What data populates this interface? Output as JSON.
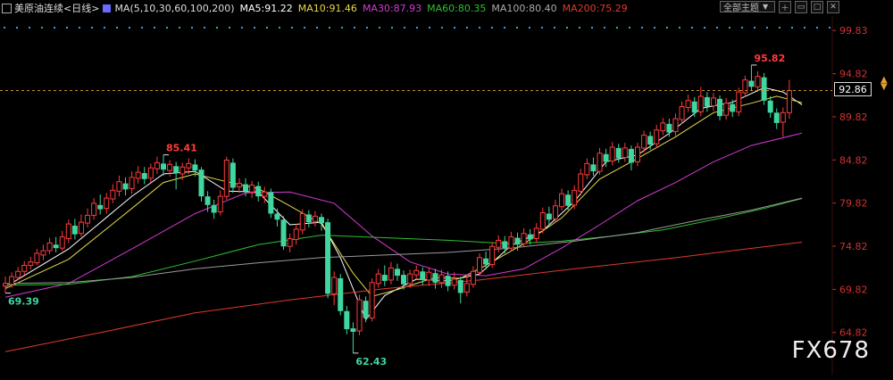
{
  "header": {
    "symbol": "美原油连续",
    "period": "<日线>",
    "ma_label": "MA(5,10,30,60,100,200)",
    "ma5": "MA5:91.22",
    "ma10": "MA10:91.46",
    "ma30": "MA30:87.93",
    "ma60": "MA60:80.35",
    "ma100": "MA100:80.40",
    "ma200": "MA200:75.29",
    "dropdown": "全部主题",
    "colors": {
      "ma5": "#ffffff",
      "ma10": "#e6d94a",
      "ma30": "#d23bd2",
      "ma60": "#2fbf2f",
      "ma100": "#9a9a9a",
      "ma200": "#e03a2a"
    }
  },
  "price_box": "92.86",
  "watermark": "FX678",
  "chart_data": {
    "type": "candlestick",
    "y_ticks": [
      "99.83",
      "94.82",
      "89.82",
      "84.82",
      "79.82",
      "74.82",
      "69.82",
      "64.82"
    ],
    "ylim": [
      62.0,
      101.5
    ],
    "current_price": 92.86,
    "annotations": [
      {
        "label": "85.41",
        "value": 85.41,
        "type": "high"
      },
      {
        "label": "69.39",
        "value": 69.39,
        "type": "low"
      },
      {
        "label": "62.43",
        "value": 62.43,
        "type": "low"
      },
      {
        "label": "95.82",
        "value": 95.82,
        "type": "high"
      }
    ],
    "candles": [
      [
        70.2,
        70.5,
        71.3,
        69.39
      ],
      [
        70.4,
        71.3,
        71.8,
        70.0
      ],
      [
        71.2,
        71.9,
        72.4,
        70.9
      ],
      [
        71.9,
        72.6,
        73.1,
        71.5
      ],
      [
        72.6,
        73.0,
        73.6,
        72.1
      ],
      [
        72.9,
        74.0,
        74.5,
        72.6
      ],
      [
        73.8,
        74.3,
        75.0,
        73.2
      ],
      [
        74.3,
        75.2,
        75.8,
        73.9
      ],
      [
        75.0,
        74.6,
        75.9,
        74.1
      ],
      [
        74.6,
        75.9,
        76.6,
        74.3
      ],
      [
        75.7,
        77.4,
        77.9,
        75.2
      ],
      [
        77.2,
        76.2,
        78.0,
        75.6
      ],
      [
        76.3,
        77.6,
        78.5,
        75.9
      ],
      [
        77.5,
        78.4,
        79.2,
        77.0
      ],
      [
        78.4,
        79.8,
        80.4,
        77.9
      ],
      [
        79.6,
        79.1,
        80.8,
        78.5
      ],
      [
        79.2,
        80.4,
        81.0,
        78.6
      ],
      [
        80.3,
        81.3,
        82.0,
        79.8
      ],
      [
        81.2,
        82.3,
        83.0,
        80.6
      ],
      [
        82.1,
        81.4,
        82.8,
        80.7
      ],
      [
        81.5,
        82.8,
        83.5,
        80.9
      ],
      [
        82.7,
        83.4,
        84.1,
        82.1
      ],
      [
        83.3,
        82.6,
        84.0,
        82.0
      ],
      [
        82.7,
        83.9,
        84.4,
        82.2
      ],
      [
        83.8,
        84.5,
        85.2,
        83.2
      ],
      [
        84.4,
        83.7,
        85.41,
        83.0
      ],
      [
        83.6,
        84.3,
        84.8,
        82.9
      ],
      [
        84.1,
        83.3,
        84.6,
        81.4
      ],
      [
        83.2,
        84.0,
        84.5,
        82.5
      ],
      [
        83.9,
        84.4,
        85.0,
        83.2
      ],
      [
        84.3,
        83.6,
        84.9,
        82.9
      ],
      [
        83.7,
        80.6,
        84.0,
        80.0
      ],
      [
        80.6,
        79.6,
        81.2,
        78.8
      ],
      [
        79.6,
        78.7,
        80.2,
        78.0
      ],
      [
        78.8,
        80.6,
        81.3,
        78.4
      ],
      [
        80.6,
        84.8,
        85.2,
        80.2
      ],
      [
        84.5,
        81.6,
        85.0,
        81.0
      ],
      [
        81.7,
        82.1,
        82.7,
        81.0
      ],
      [
        82.0,
        81.2,
        82.7,
        80.6
      ],
      [
        81.1,
        81.9,
        82.4,
        80.4
      ],
      [
        81.8,
        80.6,
        82.3,
        80.0
      ],
      [
        80.6,
        81.1,
        81.7,
        79.8
      ],
      [
        81.1,
        78.6,
        81.5,
        78.1
      ],
      [
        78.6,
        77.9,
        79.2,
        77.1
      ],
      [
        77.9,
        74.8,
        78.3,
        74.4
      ],
      [
        74.8,
        75.7,
        76.3,
        74.1
      ],
      [
        75.6,
        76.8,
        77.4,
        75.0
      ],
      [
        76.7,
        78.6,
        79.1,
        76.2
      ],
      [
        78.5,
        77.6,
        79.0,
        77.0
      ],
      [
        77.7,
        78.3,
        78.9,
        77.1
      ],
      [
        78.2,
        77.5,
        78.6,
        76.6
      ],
      [
        77.6,
        69.3,
        78.0,
        68.8
      ],
      [
        69.3,
        71.2,
        71.9,
        68.0
      ],
      [
        71.1,
        67.3,
        71.6,
        66.8
      ],
      [
        67.3,
        65.2,
        67.9,
        64.6
      ],
      [
        65.3,
        64.9,
        66.0,
        62.43
      ],
      [
        65.0,
        68.6,
        69.2,
        64.5
      ],
      [
        68.5,
        66.5,
        69.0,
        66.0
      ],
      [
        66.5,
        70.6,
        71.1,
        66.1
      ],
      [
        70.5,
        71.6,
        72.2,
        70.0
      ],
      [
        71.5,
        70.8,
        72.6,
        70.2
      ],
      [
        70.9,
        72.3,
        73.0,
        70.4
      ],
      [
        72.2,
        71.4,
        72.8,
        70.8
      ],
      [
        71.5,
        70.4,
        72.0,
        69.8
      ],
      [
        70.5,
        71.6,
        72.1,
        70.0
      ],
      [
        71.5,
        72.0,
        72.6,
        71.0
      ],
      [
        71.9,
        70.9,
        72.4,
        70.3
      ],
      [
        70.9,
        71.8,
        72.4,
        70.2
      ],
      [
        71.7,
        70.6,
        72.2,
        69.9
      ],
      [
        70.6,
        71.5,
        72.1,
        70.0
      ],
      [
        71.4,
        70.2,
        71.9,
        69.6
      ],
      [
        70.3,
        71.0,
        71.8,
        69.8
      ],
      [
        70.9,
        69.4,
        71.3,
        68.2
      ],
      [
        69.5,
        70.5,
        71.4,
        69.0
      ],
      [
        70.4,
        71.9,
        72.5,
        70.0
      ],
      [
        71.8,
        73.5,
        74.0,
        71.4
      ],
      [
        73.4,
        72.7,
        74.2,
        72.1
      ],
      [
        72.7,
        74.8,
        75.3,
        72.3
      ],
      [
        74.7,
        75.5,
        76.1,
        74.1
      ],
      [
        75.4,
        74.6,
        76.0,
        74.0
      ],
      [
        74.6,
        75.9,
        76.5,
        74.2
      ],
      [
        75.8,
        75.0,
        76.4,
        74.3
      ],
      [
        75.1,
        76.3,
        76.9,
        74.7
      ],
      [
        76.2,
        75.6,
        76.8,
        75.0
      ],
      [
        75.7,
        76.9,
        77.5,
        75.2
      ],
      [
        76.8,
        78.7,
        79.3,
        76.3
      ],
      [
        78.6,
        77.9,
        79.4,
        77.3
      ],
      [
        78.0,
        79.5,
        80.2,
        77.6
      ],
      [
        79.4,
        80.9,
        81.5,
        79.0
      ],
      [
        80.8,
        79.5,
        81.3,
        79.0
      ],
      [
        79.6,
        81.3,
        81.9,
        79.1
      ],
      [
        81.2,
        83.2,
        83.8,
        80.7
      ],
      [
        83.1,
        84.4,
        85.0,
        82.6
      ],
      [
        84.3,
        83.5,
        85.1,
        83.0
      ],
      [
        83.5,
        85.6,
        86.2,
        83.1
      ],
      [
        85.5,
        84.6,
        86.1,
        84.0
      ],
      [
        84.7,
        86.3,
        86.9,
        84.2
      ],
      [
        86.2,
        85.0,
        86.7,
        84.5
      ],
      [
        85.1,
        86.2,
        86.8,
        84.6
      ],
      [
        86.1,
        84.5,
        86.5,
        83.6
      ],
      [
        84.6,
        86.3,
        86.8,
        84.1
      ],
      [
        86.2,
        87.7,
        88.2,
        85.7
      ],
      [
        87.6,
        86.6,
        88.1,
        86.0
      ],
      [
        86.7,
        88.3,
        88.9,
        86.2
      ],
      [
        88.2,
        89.1,
        89.7,
        87.7
      ],
      [
        89.0,
        88.0,
        89.6,
        87.5
      ],
      [
        88.1,
        89.6,
        90.2,
        87.6
      ],
      [
        89.5,
        91.0,
        91.6,
        89.0
      ],
      [
        90.9,
        91.7,
        92.4,
        90.4
      ],
      [
        91.6,
        90.3,
        92.1,
        89.8
      ],
      [
        90.4,
        92.2,
        93.3,
        89.9
      ],
      [
        92.1,
        91.0,
        92.7,
        90.4
      ],
      [
        91.1,
        92.0,
        92.6,
        90.5
      ],
      [
        91.9,
        89.9,
        92.3,
        89.4
      ],
      [
        90.0,
        91.4,
        92.0,
        89.5
      ],
      [
        91.3,
        90.4,
        91.8,
        89.8
      ],
      [
        90.4,
        92.7,
        93.2,
        89.9
      ],
      [
        92.6,
        94.1,
        94.6,
        92.1
      ],
      [
        94.0,
        93.3,
        95.82,
        92.8
      ],
      [
        93.3,
        94.5,
        95.1,
        92.7
      ],
      [
        94.4,
        91.7,
        94.9,
        91.2
      ],
      [
        91.7,
        90.3,
        92.2,
        89.7
      ],
      [
        90.3,
        89.1,
        90.8,
        88.4
      ],
      [
        89.2,
        90.3,
        90.9,
        87.5
      ],
      [
        90.3,
        92.86,
        94.1,
        89.6
      ]
    ],
    "ma_lines": {
      "ma5": [
        [
          0,
          70.1
        ],
        [
          10,
          74.5
        ],
        [
          20,
          80.6
        ],
        [
          25,
          83.2
        ],
        [
          30,
          83.5
        ],
        [
          35,
          81.2
        ],
        [
          40,
          81.1
        ],
        [
          45,
          77.3
        ],
        [
          50,
          77.6
        ],
        [
          53,
          73.5
        ],
        [
          57,
          66.3
        ],
        [
          60,
          69.1
        ],
        [
          65,
          71.0
        ],
        [
          70,
          70.8
        ],
        [
          75,
          71.6
        ],
        [
          80,
          74.9
        ],
        [
          85,
          76.6
        ],
        [
          90,
          80.0
        ],
        [
          95,
          84.6
        ],
        [
          100,
          85.4
        ],
        [
          105,
          87.9
        ],
        [
          110,
          90.8
        ],
        [
          115,
          91.5
        ],
        [
          120,
          93.2
        ],
        [
          123,
          92.7
        ],
        [
          126,
          91.22
        ]
      ],
      "ma10": [
        [
          0,
          69.9
        ],
        [
          10,
          73.3
        ],
        [
          20,
          79.2
        ],
        [
          25,
          82.2
        ],
        [
          30,
          83.2
        ],
        [
          35,
          82.3
        ],
        [
          40,
          81.5
        ],
        [
          45,
          79.5
        ],
        [
          50,
          77.4
        ],
        [
          55,
          71.7
        ],
        [
          58,
          69.0
        ],
        [
          62,
          69.8
        ],
        [
          68,
          71.2
        ],
        [
          72,
          71.1
        ],
        [
          76,
          72.6
        ],
        [
          82,
          75.1
        ],
        [
          88,
          78.1
        ],
        [
          94,
          82.6
        ],
        [
          100,
          85.0
        ],
        [
          106,
          87.5
        ],
        [
          112,
          90.3
        ],
        [
          118,
          91.4
        ],
        [
          122,
          92.2
        ],
        [
          126,
          91.46
        ]
      ],
      "ma30": [
        [
          0,
          68.9
        ],
        [
          10,
          70.5
        ],
        [
          20,
          74.5
        ],
        [
          30,
          78.6
        ],
        [
          38,
          81.0
        ],
        [
          45,
          81.1
        ],
        [
          52,
          79.8
        ],
        [
          58,
          76.0
        ],
        [
          64,
          73.0
        ],
        [
          70,
          71.6
        ],
        [
          76,
          71.4
        ],
        [
          82,
          72.2
        ],
        [
          88,
          74.6
        ],
        [
          94,
          77.3
        ],
        [
          100,
          80.1
        ],
        [
          106,
          82.2
        ],
        [
          112,
          84.6
        ],
        [
          118,
          86.5
        ],
        [
          126,
          87.93
        ]
      ],
      "ma60": [
        [
          0,
          70.3
        ],
        [
          10,
          70.4
        ],
        [
          20,
          71.3
        ],
        [
          30,
          73.1
        ],
        [
          40,
          75.0
        ],
        [
          50,
          76.1
        ],
        [
          60,
          75.8
        ],
        [
          70,
          75.5
        ],
        [
          80,
          75.1
        ],
        [
          88,
          75.4
        ],
        [
          96,
          76.0
        ],
        [
          104,
          76.7
        ],
        [
          112,
          77.9
        ],
        [
          120,
          79.2
        ],
        [
          126,
          80.35
        ]
      ],
      "ma100": [
        [
          0,
          70.5
        ],
        [
          10,
          70.6
        ],
        [
          20,
          71.2
        ],
        [
          30,
          72.2
        ],
        [
          40,
          72.9
        ],
        [
          50,
          73.5
        ],
        [
          60,
          73.8
        ],
        [
          70,
          74.1
        ],
        [
          80,
          74.6
        ],
        [
          90,
          75.4
        ],
        [
          100,
          76.4
        ],
        [
          110,
          77.9
        ],
        [
          118,
          79.0
        ],
        [
          126,
          80.4
        ]
      ],
      "ma200": [
        [
          0,
          62.6
        ],
        [
          15,
          64.8
        ],
        [
          30,
          67.1
        ],
        [
          45,
          68.6
        ],
        [
          60,
          69.9
        ],
        [
          75,
          70.9
        ],
        [
          90,
          72.2
        ],
        [
          105,
          73.4
        ],
        [
          115,
          74.3
        ],
        [
          126,
          75.29
        ]
      ]
    }
  }
}
